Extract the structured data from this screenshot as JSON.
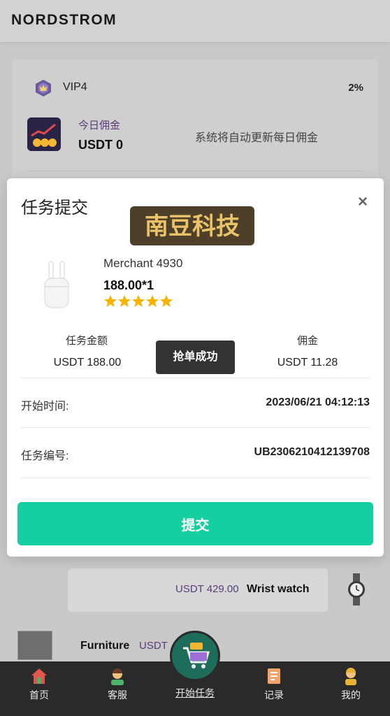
{
  "header": {
    "brand": "NORDSTROM"
  },
  "account": {
    "vip_level": "VIP4",
    "vip_percent": "2%",
    "commission_title": "今日佣金",
    "commission_value": "USDT 0",
    "commission_note": "系统将自动更新每日佣金"
  },
  "product_rows": [
    {
      "price": "USDT 429.00",
      "name": "Wrist watch",
      "icon": "watch-icon"
    },
    {
      "name": "Furniture",
      "price": "USDT",
      "icon": "sofa-image"
    }
  ],
  "modal": {
    "title": "任务提交",
    "close_label": "×",
    "watermark_text": "南豆科技",
    "merchant": "Merchant 4930",
    "price_qty": "188.00*1",
    "rating": 5,
    "amount_label": "任务金额",
    "amount_value": "USDT 188.00",
    "commission_label": "佣金",
    "commission_value": "USDT 11.28",
    "toast": "抢单成功",
    "start_time_label": "开始时间:",
    "start_time_value": "2023/06/21 04:12:13",
    "task_no_label": "任务编号:",
    "task_no_value": "UB2306210412139708",
    "submit_label": "提交"
  },
  "nav": {
    "home": "首页",
    "service": "客服",
    "start": "开始任务",
    "records": "记录",
    "mine": "我的"
  },
  "colors": {
    "accent": "#16cfa0",
    "nav_bg": "#2a2a2a",
    "toast_bg": "#333333",
    "price_purple": "#5b3b7a",
    "star": "#f6b400"
  }
}
